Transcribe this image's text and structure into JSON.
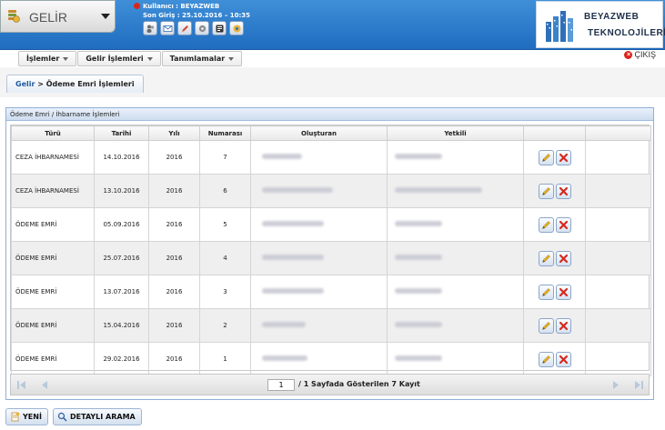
{
  "header": {
    "module_title": "GELİR",
    "user_line": "Kullanıcı : BEYAZWEB",
    "login_line": "Son Giriş : 25.10.2016 – 10:35",
    "logo_line1": "BEYAZWEB",
    "logo_line2": "TEKNOLOJİLERİ"
  },
  "menu": {
    "items": [
      "İşlemler",
      "Gelir İşlemleri",
      "Tanımlamalar"
    ],
    "logout": "ÇIKIŞ"
  },
  "breadcrumb": {
    "root": "Gelir",
    "sep": " > ",
    "page": "Ödeme Emri İşlemleri"
  },
  "panel": {
    "title": "Ödeme Emri / İhbarname İşlemleri"
  },
  "table": {
    "columns": [
      "Türü",
      "Tarihi",
      "Yılı",
      "Numarası",
      "Oluşturan",
      "Yetkili",
      "",
      ""
    ],
    "rows": [
      {
        "type": "CEZA İHBARNAMESİ",
        "date": "14.10.2016",
        "year": "2016",
        "number": "7"
      },
      {
        "type": "CEZA İHBARNAMESİ",
        "date": "13.10.2016",
        "year": "2016",
        "number": "6"
      },
      {
        "type": "ÖDEME EMRİ",
        "date": "05.09.2016",
        "year": "2016",
        "number": "5"
      },
      {
        "type": "ÖDEME EMRİ",
        "date": "25.07.2016",
        "year": "2016",
        "number": "4"
      },
      {
        "type": "ÖDEME EMRİ",
        "date": "13.07.2016",
        "year": "2016",
        "number": "3"
      },
      {
        "type": "ÖDEME EMRİ",
        "date": "15.04.2016",
        "year": "2016",
        "number": "2"
      },
      {
        "type": "ÖDEME EMRİ",
        "date": "29.02.2016",
        "year": "2016",
        "number": "1"
      }
    ]
  },
  "pager": {
    "page_value": "1",
    "info": "/ 1 Sayfada Gösterilen 7 Kayıt"
  },
  "buttons": {
    "new_label": "YENİ",
    "search_label": "DETAYLI ARAMA"
  },
  "colors": {
    "header_blue": "#2a7bd0",
    "accent_red": "#d9261c"
  }
}
